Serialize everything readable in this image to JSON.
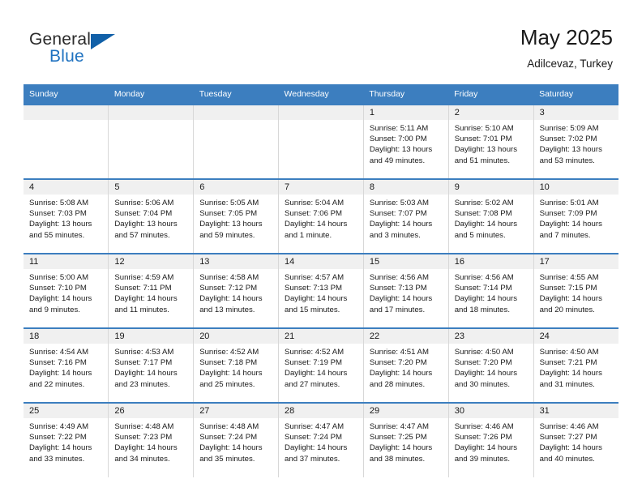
{
  "branding": {
    "logo_primary": "General",
    "logo_secondary": "Blue"
  },
  "header": {
    "title": "May 2025",
    "subtitle": "Adilcevaz, Turkey"
  },
  "colors": {
    "header_blue": "#3c7ebf",
    "logo_blue": "#1f72c0",
    "day_band": "#f0f0f0"
  },
  "weekday_headers": [
    "Sunday",
    "Monday",
    "Tuesday",
    "Wednesday",
    "Thursday",
    "Friday",
    "Saturday"
  ],
  "labels": {
    "sunrise": "Sunrise:",
    "sunset": "Sunset:",
    "daylight": "Daylight:"
  },
  "weeks": [
    [
      {
        "day": "",
        "sunrise": "",
        "sunset": "",
        "daylight": "",
        "blank": true
      },
      {
        "day": "",
        "sunrise": "",
        "sunset": "",
        "daylight": "",
        "blank": true
      },
      {
        "day": "",
        "sunrise": "",
        "sunset": "",
        "daylight": "",
        "blank": true
      },
      {
        "day": "",
        "sunrise": "",
        "sunset": "",
        "daylight": "",
        "blank": true
      },
      {
        "day": "1",
        "sunrise": "Sunrise: 5:11 AM",
        "sunset": "Sunset: 7:00 PM",
        "daylight": "Daylight: 13 hours and 49 minutes."
      },
      {
        "day": "2",
        "sunrise": "Sunrise: 5:10 AM",
        "sunset": "Sunset: 7:01 PM",
        "daylight": "Daylight: 13 hours and 51 minutes."
      },
      {
        "day": "3",
        "sunrise": "Sunrise: 5:09 AM",
        "sunset": "Sunset: 7:02 PM",
        "daylight": "Daylight: 13 hours and 53 minutes."
      }
    ],
    [
      {
        "day": "4",
        "sunrise": "Sunrise: 5:08 AM",
        "sunset": "Sunset: 7:03 PM",
        "daylight": "Daylight: 13 hours and 55 minutes."
      },
      {
        "day": "5",
        "sunrise": "Sunrise: 5:06 AM",
        "sunset": "Sunset: 7:04 PM",
        "daylight": "Daylight: 13 hours and 57 minutes."
      },
      {
        "day": "6",
        "sunrise": "Sunrise: 5:05 AM",
        "sunset": "Sunset: 7:05 PM",
        "daylight": "Daylight: 13 hours and 59 minutes."
      },
      {
        "day": "7",
        "sunrise": "Sunrise: 5:04 AM",
        "sunset": "Sunset: 7:06 PM",
        "daylight": "Daylight: 14 hours and 1 minute."
      },
      {
        "day": "8",
        "sunrise": "Sunrise: 5:03 AM",
        "sunset": "Sunset: 7:07 PM",
        "daylight": "Daylight: 14 hours and 3 minutes."
      },
      {
        "day": "9",
        "sunrise": "Sunrise: 5:02 AM",
        "sunset": "Sunset: 7:08 PM",
        "daylight": "Daylight: 14 hours and 5 minutes."
      },
      {
        "day": "10",
        "sunrise": "Sunrise: 5:01 AM",
        "sunset": "Sunset: 7:09 PM",
        "daylight": "Daylight: 14 hours and 7 minutes."
      }
    ],
    [
      {
        "day": "11",
        "sunrise": "Sunrise: 5:00 AM",
        "sunset": "Sunset: 7:10 PM",
        "daylight": "Daylight: 14 hours and 9 minutes."
      },
      {
        "day": "12",
        "sunrise": "Sunrise: 4:59 AM",
        "sunset": "Sunset: 7:11 PM",
        "daylight": "Daylight: 14 hours and 11 minutes."
      },
      {
        "day": "13",
        "sunrise": "Sunrise: 4:58 AM",
        "sunset": "Sunset: 7:12 PM",
        "daylight": "Daylight: 14 hours and 13 minutes."
      },
      {
        "day": "14",
        "sunrise": "Sunrise: 4:57 AM",
        "sunset": "Sunset: 7:13 PM",
        "daylight": "Daylight: 14 hours and 15 minutes."
      },
      {
        "day": "15",
        "sunrise": "Sunrise: 4:56 AM",
        "sunset": "Sunset: 7:13 PM",
        "daylight": "Daylight: 14 hours and 17 minutes."
      },
      {
        "day": "16",
        "sunrise": "Sunrise: 4:56 AM",
        "sunset": "Sunset: 7:14 PM",
        "daylight": "Daylight: 14 hours and 18 minutes."
      },
      {
        "day": "17",
        "sunrise": "Sunrise: 4:55 AM",
        "sunset": "Sunset: 7:15 PM",
        "daylight": "Daylight: 14 hours and 20 minutes."
      }
    ],
    [
      {
        "day": "18",
        "sunrise": "Sunrise: 4:54 AM",
        "sunset": "Sunset: 7:16 PM",
        "daylight": "Daylight: 14 hours and 22 minutes."
      },
      {
        "day": "19",
        "sunrise": "Sunrise: 4:53 AM",
        "sunset": "Sunset: 7:17 PM",
        "daylight": "Daylight: 14 hours and 23 minutes."
      },
      {
        "day": "20",
        "sunrise": "Sunrise: 4:52 AM",
        "sunset": "Sunset: 7:18 PM",
        "daylight": "Daylight: 14 hours and 25 minutes."
      },
      {
        "day": "21",
        "sunrise": "Sunrise: 4:52 AM",
        "sunset": "Sunset: 7:19 PM",
        "daylight": "Daylight: 14 hours and 27 minutes."
      },
      {
        "day": "22",
        "sunrise": "Sunrise: 4:51 AM",
        "sunset": "Sunset: 7:20 PM",
        "daylight": "Daylight: 14 hours and 28 minutes."
      },
      {
        "day": "23",
        "sunrise": "Sunrise: 4:50 AM",
        "sunset": "Sunset: 7:20 PM",
        "daylight": "Daylight: 14 hours and 30 minutes."
      },
      {
        "day": "24",
        "sunrise": "Sunrise: 4:50 AM",
        "sunset": "Sunset: 7:21 PM",
        "daylight": "Daylight: 14 hours and 31 minutes."
      }
    ],
    [
      {
        "day": "25",
        "sunrise": "Sunrise: 4:49 AM",
        "sunset": "Sunset: 7:22 PM",
        "daylight": "Daylight: 14 hours and 33 minutes."
      },
      {
        "day": "26",
        "sunrise": "Sunrise: 4:48 AM",
        "sunset": "Sunset: 7:23 PM",
        "daylight": "Daylight: 14 hours and 34 minutes."
      },
      {
        "day": "27",
        "sunrise": "Sunrise: 4:48 AM",
        "sunset": "Sunset: 7:24 PM",
        "daylight": "Daylight: 14 hours and 35 minutes."
      },
      {
        "day": "28",
        "sunrise": "Sunrise: 4:47 AM",
        "sunset": "Sunset: 7:24 PM",
        "daylight": "Daylight: 14 hours and 37 minutes."
      },
      {
        "day": "29",
        "sunrise": "Sunrise: 4:47 AM",
        "sunset": "Sunset: 7:25 PM",
        "daylight": "Daylight: 14 hours and 38 minutes."
      },
      {
        "day": "30",
        "sunrise": "Sunrise: 4:46 AM",
        "sunset": "Sunset: 7:26 PM",
        "daylight": "Daylight: 14 hours and 39 minutes."
      },
      {
        "day": "31",
        "sunrise": "Sunrise: 4:46 AM",
        "sunset": "Sunset: 7:27 PM",
        "daylight": "Daylight: 14 hours and 40 minutes."
      }
    ]
  ]
}
